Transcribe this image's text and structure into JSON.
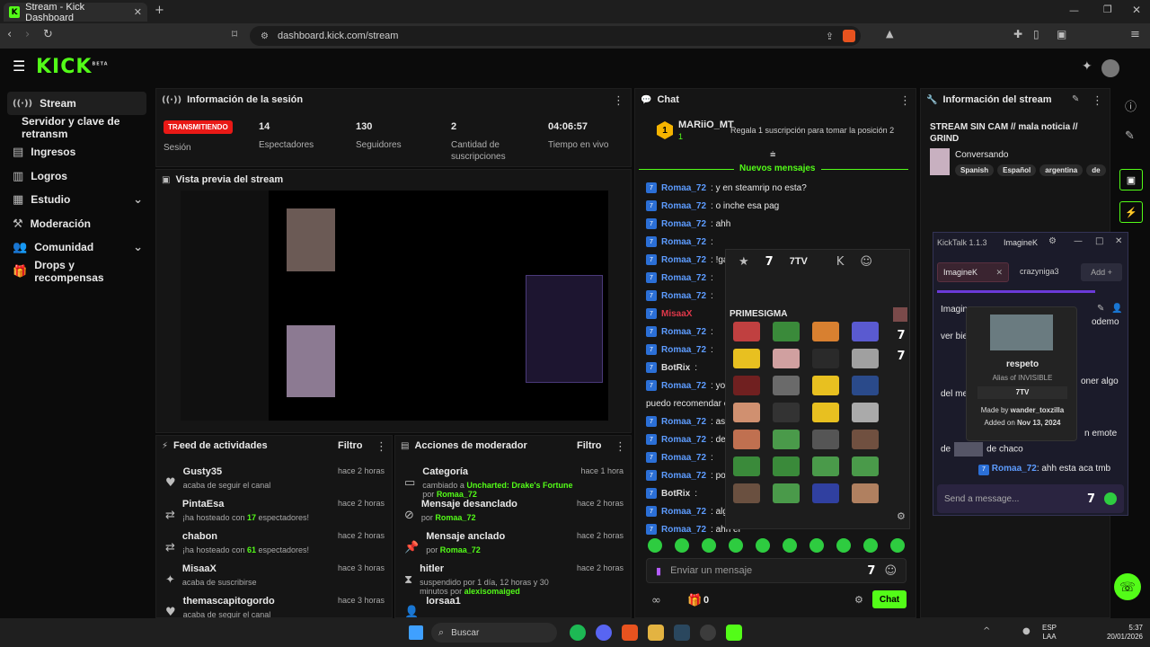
{
  "browser": {
    "tab_title": "Stream - Kick Dashboard",
    "url": "dashboard.kick.com/stream"
  },
  "logo": {
    "text": "KICK",
    "beta": "BETA"
  },
  "sidebar": {
    "items": [
      {
        "label": "Stream"
      },
      {
        "label": "Servidor y clave de retransm"
      },
      {
        "label": "Ingresos"
      },
      {
        "label": "Logros"
      },
      {
        "label": "Estudio"
      },
      {
        "label": "Moderación"
      },
      {
        "label": "Comunidad"
      },
      {
        "label": "Drops y recompensas"
      }
    ]
  },
  "session": {
    "title": "Información de la sesión",
    "live_badge": "TRANSMITIENDO",
    "session_label": "Sesión",
    "stats": [
      {
        "value": "14",
        "label": "Espectadores"
      },
      {
        "value": "130",
        "label": "Seguidores"
      },
      {
        "value": "2",
        "label": "Cantidad de suscripciones"
      },
      {
        "value": "04:06:57",
        "label": "Tiempo en vivo"
      }
    ]
  },
  "preview": {
    "title": "Vista previa del stream"
  },
  "activity": {
    "title": "Feed de actividades",
    "filter": "Filtro",
    "items": [
      {
        "name": "Gusty35",
        "desc": "acaba de seguir el canal",
        "time": "hace 2 horas"
      },
      {
        "name": "PintaEsa",
        "desc_pre": "¡ha hosteado con ",
        "count": "17",
        "desc_post": " espectadores!",
        "time": "hace 2 horas"
      },
      {
        "name": "chabon",
        "desc_pre": "¡ha hosteado con ",
        "count": "61",
        "desc_post": " espectadores!",
        "time": "hace 2 horas"
      },
      {
        "name": "MisaaX",
        "desc": "acaba de suscribirse",
        "time": "hace 3 horas"
      },
      {
        "name": "themascapitogordo",
        "desc": "acaba de seguir el canal",
        "time": "hace 3 horas"
      }
    ]
  },
  "modactions": {
    "title": "Acciones de moderador",
    "filter": "Filtro",
    "items": [
      {
        "name": "Categoría",
        "desc_pre": "cambiado a ",
        "link": "Uncharted: Drake's Fortune",
        "desc_mid": " por ",
        "by": "Romaa_72",
        "time": "hace 1 hora"
      },
      {
        "name": "Mensaje desanclado",
        "desc_pre": "por ",
        "by": "Romaa_72",
        "time": "hace 2 horas"
      },
      {
        "name": "Mensaje anclado",
        "desc_pre": "por ",
        "by": "Romaa_72",
        "time": "hace 2 horas"
      },
      {
        "name": "hitler",
        "desc_pre": "suspendido por 1 día, 12 horas y 30 minutos por ",
        "by": "alexisomaiged",
        "time": "hace 2 horas"
      },
      {
        "name": "lorsaa1",
        "time": ""
      }
    ]
  },
  "chat": {
    "title": "Chat",
    "top_user": "MARiiO_MT",
    "top_count": "1",
    "gift_text": "Regala 1 suscripción para tomar la posición 2",
    "new_messages": "Nuevos mensajes",
    "messages": [
      {
        "user": "Romaa_72",
        "text": ": y en steamrip no esta?"
      },
      {
        "user": "Romaa_72",
        "text": ": o inche esa pag"
      },
      {
        "user": "Romaa_72",
        "text": ": ahh"
      },
      {
        "user": "Romaa_72",
        "text": ":"
      },
      {
        "user": "Romaa_72",
        "text": ": !game"
      },
      {
        "user": "Romaa_72",
        "text": ":"
      },
      {
        "user": "Romaa_72",
        "text": ":"
      },
      {
        "user": "MisaaX",
        "text": ""
      },
      {
        "user": "Romaa_72",
        "text": ":"
      },
      {
        "user": "Romaa_72",
        "text": ":"
      },
      {
        "user": "BotRix",
        "text": ":"
      },
      {
        "user": "Romaa_72",
        "text": ": yo no"
      },
      {
        "user": "",
        "text": "puedo recomendar e"
      },
      {
        "user": "Romaa_72",
        "text": ": asi co"
      },
      {
        "user": "Romaa_72",
        "text": ": despu"
      },
      {
        "user": "Romaa_72",
        "text": ":"
      },
      {
        "user": "Romaa_72",
        "text": ": podes"
      },
      {
        "user": "BotRix",
        "text": ":"
      },
      {
        "user": "Romaa_72",
        "text": ": algo ti"
      },
      {
        "user": "Romaa_72",
        "text": ": ahh er"
      }
    ],
    "input_placeholder": "Enviar un mensaje",
    "send": "Chat",
    "count": "0"
  },
  "emotes": {
    "tab_7tv": "7TV",
    "set_name": "PRIMESIGMA"
  },
  "streaminfo": {
    "title": "Información del stream",
    "stream_title": "STREAM SIN CAM // mala noticia // GRIND",
    "category": "Conversando",
    "tags": [
      "Spanish",
      "Español",
      "argentina",
      "de"
    ]
  },
  "kicktalk": {
    "title": "KickTalk 1.1.3",
    "user": "ImagineK",
    "tab1": "ImagineK",
    "tab2": "crazynigа3",
    "add": "Add",
    "partial_user": "Imagin",
    "lines": [
      {
        "text": "ver bie"
      },
      {
        "text": "del me"
      },
      {
        "text": "de",
        "suffix": "de chaco"
      },
      {
        "text": "odemo"
      },
      {
        "text": "oner algo"
      },
      {
        "text": "n emote"
      }
    ],
    "last_user": "Romaa_72",
    "last_text": ": ahh esta aca tmb",
    "input_placeholder": "Send a message...",
    "emote_card": {
      "name": "respeto",
      "alias": "Alias of INVISIBLE",
      "provider": "7TV",
      "made_by_label": "Made by ",
      "made_by": "wander_toxzilla",
      "added_label": "Added on ",
      "added": "Nov 13, 2024"
    }
  },
  "taskbar": {
    "search": "Buscar",
    "lang1": "ESP",
    "lang2": "LAA",
    "time": "5:37",
    "date": "20/01/2026"
  }
}
